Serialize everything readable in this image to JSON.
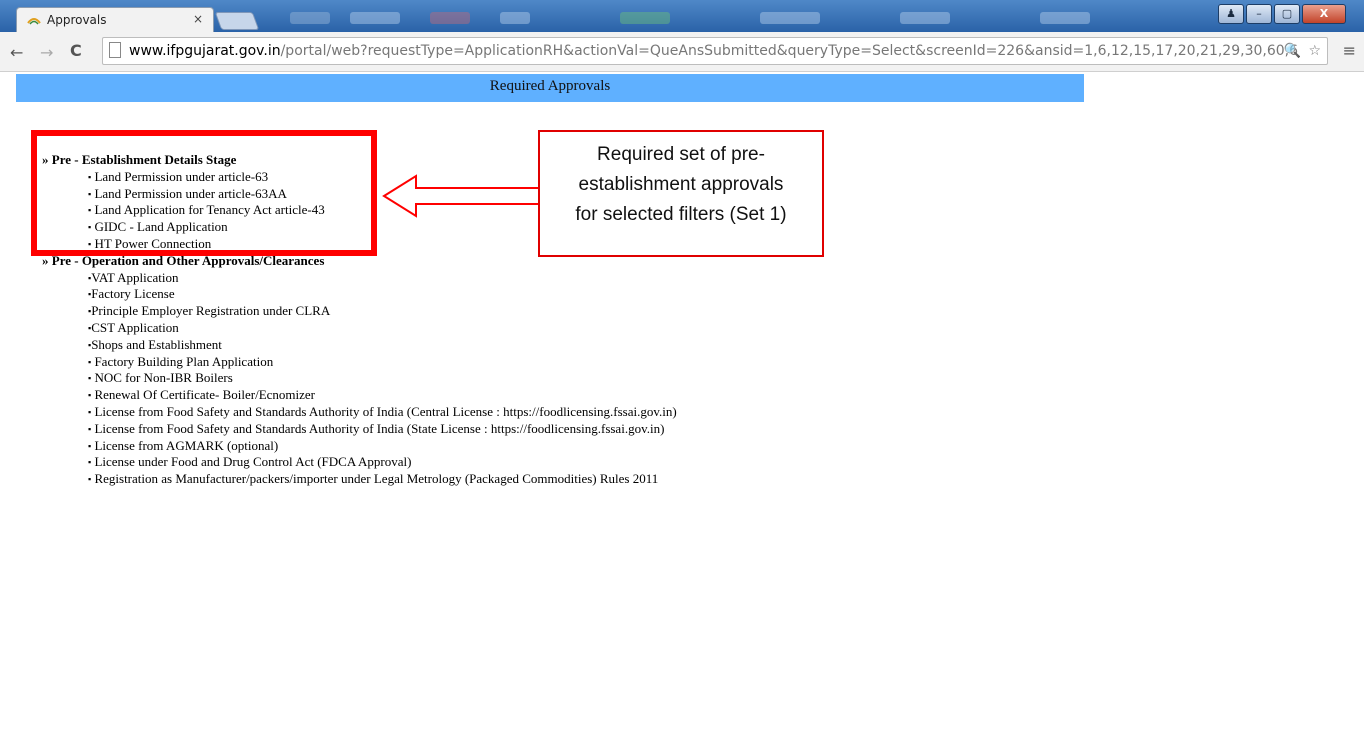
{
  "browser": {
    "tab_title": "Approvals",
    "tab_close": "×",
    "url_host": "www.ifpgujarat.gov.in",
    "url_path": "/portal/web?requestType=ApplicationRH&actionVal=QueAnsSubmitted&queryType=Select&screenId=226&ansid=1,6,12,15,17,20,21,29,30,60,6",
    "window_buttons": {
      "user": "♟",
      "minimize": "–",
      "maximize": "▢",
      "close": "X"
    }
  },
  "page": {
    "banner_title": "Required Approvals",
    "sections": [
      {
        "heading": "» Pre - Establishment Details Stage",
        "items": [
          "Land Permission under article-63",
          "Land Permission under article-63AA",
          "Land Application for Tenancy Act article-43",
          "GIDC - Land Application",
          "HT Power Connection"
        ]
      },
      {
        "heading": "» Pre - Operation and Other Approvals/Clearances",
        "items": [
          "VAT Application",
          "Factory License",
          "Principle Employer Registration under CLRA",
          "CST Application",
          "Shops and Establishment",
          "Factory Building Plan Application",
          "NOC for Non-IBR Boilers",
          "Renewal Of Certificate- Boiler/Ecnomizer",
          "License from Food Safety and Standards Authority of India (Central License : https://foodlicensing.fssai.gov.in)",
          "License from Food Safety and Standards Authority of India (State License : https://foodlicensing.fssai.gov.in)",
          "License from AGMARK (optional)",
          "License under Food and Drug Control Act (FDCA Approval)",
          "Registration as Manufacturer/packers/importer under Legal Metrology (Packaged Commodities) Rules 2011"
        ]
      }
    ]
  },
  "annotation": {
    "callout_text": "Required set of pre-establishment approvals for selected filters (Set 1)",
    "callout_lines": [
      "Required set of pre-",
      "establishment approvals",
      "for selected filters (Set 1)"
    ],
    "color": "#ff0000"
  }
}
